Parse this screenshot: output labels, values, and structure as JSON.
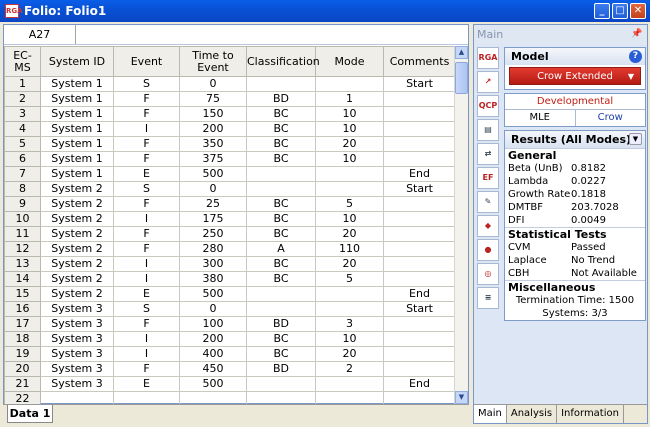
{
  "window": {
    "title": "Folio: Folio1",
    "app_icon_text": "RGA",
    "buttons": {
      "minimize": "_",
      "maximize": "□",
      "close": "✕"
    }
  },
  "formula_bar": {
    "cell_ref": "A27",
    "value": ""
  },
  "grid": {
    "columns": [
      "EC-MS",
      "System ID",
      "Event",
      "Time to Event",
      "Classification",
      "Mode",
      "Comments"
    ],
    "rows": [
      [
        "1",
        "System 1",
        "S",
        "0",
        "",
        "",
        "Start"
      ],
      [
        "2",
        "System 1",
        "F",
        "75",
        "BD",
        "1",
        ""
      ],
      [
        "3",
        "System 1",
        "F",
        "150",
        "BC",
        "10",
        ""
      ],
      [
        "4",
        "System 1",
        "I",
        "200",
        "BC",
        "10",
        ""
      ],
      [
        "5",
        "System 1",
        "F",
        "350",
        "BC",
        "20",
        ""
      ],
      [
        "6",
        "System 1",
        "F",
        "375",
        "BC",
        "10",
        ""
      ],
      [
        "7",
        "System 1",
        "E",
        "500",
        "",
        "",
        "End"
      ],
      [
        "8",
        "System 2",
        "S",
        "0",
        "",
        "",
        "Start"
      ],
      [
        "9",
        "System 2",
        "F",
        "25",
        "BC",
        "5",
        ""
      ],
      [
        "10",
        "System 2",
        "I",
        "175",
        "BC",
        "10",
        ""
      ],
      [
        "11",
        "System 2",
        "F",
        "250",
        "BC",
        "20",
        ""
      ],
      [
        "12",
        "System 2",
        "F",
        "280",
        "A",
        "110",
        ""
      ],
      [
        "13",
        "System 2",
        "I",
        "300",
        "BC",
        "20",
        ""
      ],
      [
        "14",
        "System 2",
        "I",
        "380",
        "BC",
        "5",
        ""
      ],
      [
        "15",
        "System 2",
        "E",
        "500",
        "",
        "",
        "End"
      ],
      [
        "16",
        "System 3",
        "S",
        "0",
        "",
        "",
        "Start"
      ],
      [
        "17",
        "System 3",
        "F",
        "100",
        "BD",
        "3",
        ""
      ],
      [
        "18",
        "System 3",
        "I",
        "200",
        "BC",
        "10",
        ""
      ],
      [
        "19",
        "System 3",
        "I",
        "400",
        "BC",
        "20",
        ""
      ],
      [
        "20",
        "System 3",
        "F",
        "450",
        "BD",
        "2",
        ""
      ],
      [
        "21",
        "System 3",
        "E",
        "500",
        "",
        "",
        "End"
      ],
      [
        "22",
        "",
        "",
        "",
        "",
        "",
        ""
      ]
    ]
  },
  "sheet_tabs": [
    "Data 1"
  ],
  "panel": {
    "header": "Main",
    "tools": [
      {
        "icon": "rga-folio-icon",
        "glyph": "RGA"
      },
      {
        "icon": "plot-icon",
        "glyph": "↗"
      },
      {
        "icon": "qcp-icon",
        "glyph": "QCP"
      },
      {
        "icon": "report-icon",
        "glyph": "▤"
      },
      {
        "icon": "transfer-icon",
        "glyph": "⇄"
      },
      {
        "icon": "ef-icon",
        "glyph": "EF"
      },
      {
        "icon": "notes-icon",
        "glyph": "✎"
      },
      {
        "icon": "select-icon",
        "glyph": "◆"
      },
      {
        "icon": "rank-icon",
        "glyph": "●"
      },
      {
        "icon": "settings-icon",
        "glyph": "◎"
      },
      {
        "icon": "export-icon",
        "glyph": "≡"
      }
    ],
    "model": {
      "label": "Model",
      "help": "?",
      "selected": "Crow Extended",
      "developmental": "Developmental",
      "modes": [
        "MLE",
        "Crow"
      ]
    },
    "results": {
      "title": "Results (All Modes)",
      "general_label": "General",
      "general": [
        {
          "k": "Beta (UnB)",
          "v": "0.8182"
        },
        {
          "k": "Lambda",
          "v": "0.0227"
        },
        {
          "k": "Growth Rate",
          "v": "0.1818"
        },
        {
          "k": "DMTBF",
          "v": "203.7028"
        },
        {
          "k": "DFI",
          "v": "0.0049"
        }
      ],
      "tests_label": "Statistical Tests",
      "tests": [
        {
          "k": "CVM",
          "v": "Passed"
        },
        {
          "k": "Laplace",
          "v": "No Trend"
        },
        {
          "k": "CBH",
          "v": "Not Available"
        }
      ],
      "misc_label": "Miscellaneous",
      "misc": [
        "Termination Time: 1500",
        "Systems: 3/3"
      ]
    },
    "tabs": [
      "Main",
      "Analysis",
      "Information"
    ]
  },
  "colors": {
    "accent_red": "#c01c12",
    "titlebar_blue": "#0851d6"
  }
}
